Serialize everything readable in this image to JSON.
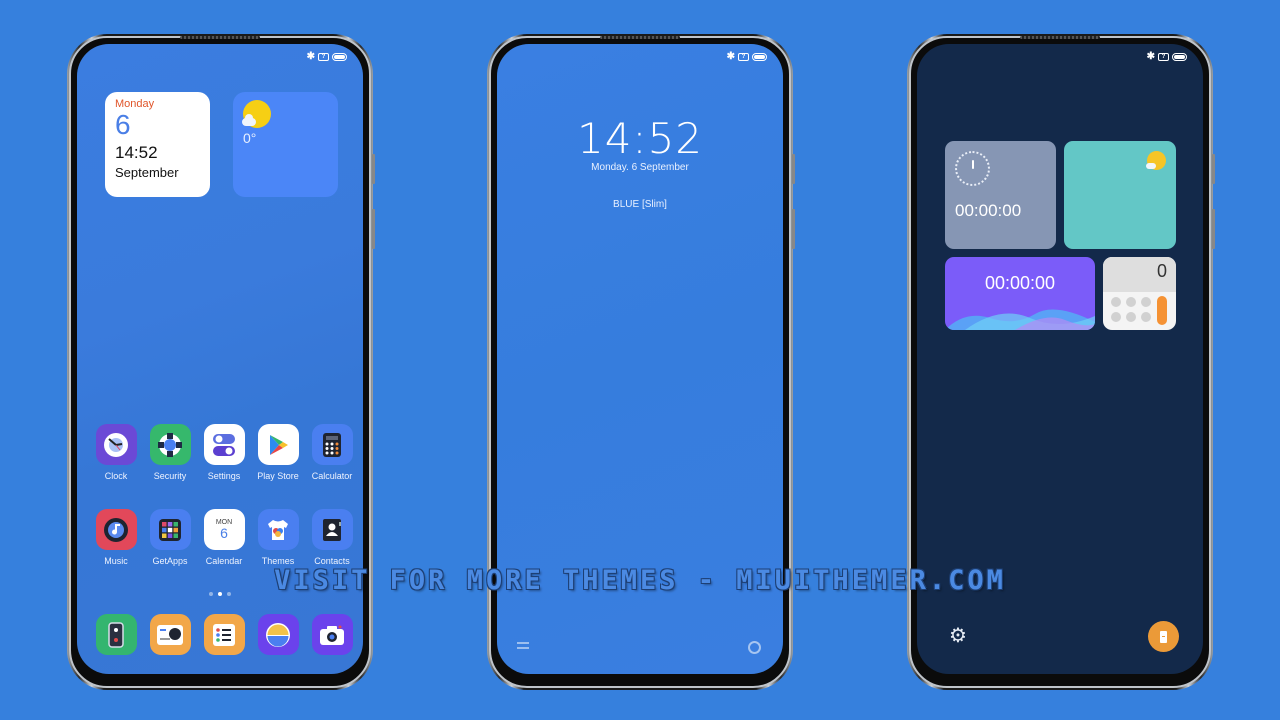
{
  "watermark": "VISIT FOR MORE THEMES - MIUITHEMER.COM",
  "status_bar": {
    "bluetooth": "bluetooth-icon",
    "sim": "?",
    "battery": "battery-full-icon"
  },
  "home_screen": {
    "calendar_widget": {
      "weekday": "Monday",
      "date": "6",
      "time": "14:52",
      "month": "September"
    },
    "weather_widget": {
      "temperature": "0°",
      "icon": "partly-sunny-icon"
    },
    "apps_row1": [
      {
        "label": "Clock",
        "icon": "clock-icon",
        "color": "#6b49d6"
      },
      {
        "label": "Security",
        "icon": "lifebuoy-icon",
        "color": "#36b86c"
      },
      {
        "label": "Settings",
        "icon": "toggles-icon",
        "color": "#ffffff"
      },
      {
        "label": "Play Store",
        "icon": "play-store-icon",
        "color": "#ffffff"
      },
      {
        "label": "Calculator",
        "icon": "calculator-icon",
        "color": "#4a7ff0"
      }
    ],
    "apps_row2": [
      {
        "label": "Music",
        "icon": "music-disc-icon",
        "color": "#e2485a"
      },
      {
        "label": "GetApps",
        "icon": "app-grid-icon",
        "color": "#4a7ff0"
      },
      {
        "label": "Calendar",
        "icon": "calendar-icon",
        "color": "#ffffff",
        "cal_day": "MON",
        "cal_date": "6"
      },
      {
        "label": "Themes",
        "icon": "tshirt-icon",
        "color": "#4a7ff0"
      },
      {
        "label": "Contacts",
        "icon": "contact-book-icon",
        "color": "#4a7ff0"
      }
    ],
    "dock": [
      {
        "icon": "phone-icon",
        "color": "#34b56f"
      },
      {
        "icon": "messages-icon",
        "color": "#f2a749"
      },
      {
        "icon": "notes-icon",
        "color": "#f2a749"
      },
      {
        "icon": "gallery-icon",
        "color": "#6b42ec"
      },
      {
        "icon": "camera-icon",
        "color": "#6b42ec"
      }
    ],
    "page_indicator": {
      "pages": 3,
      "active": 2
    }
  },
  "lock_screen": {
    "time": "14:52",
    "date": "Monday. 6 September",
    "theme_name": "BLUE [Slim]"
  },
  "control_screen": {
    "clock_widget_value": "00:00:00",
    "timer_widget_value": "00:00:00",
    "calculator_value": "0"
  }
}
